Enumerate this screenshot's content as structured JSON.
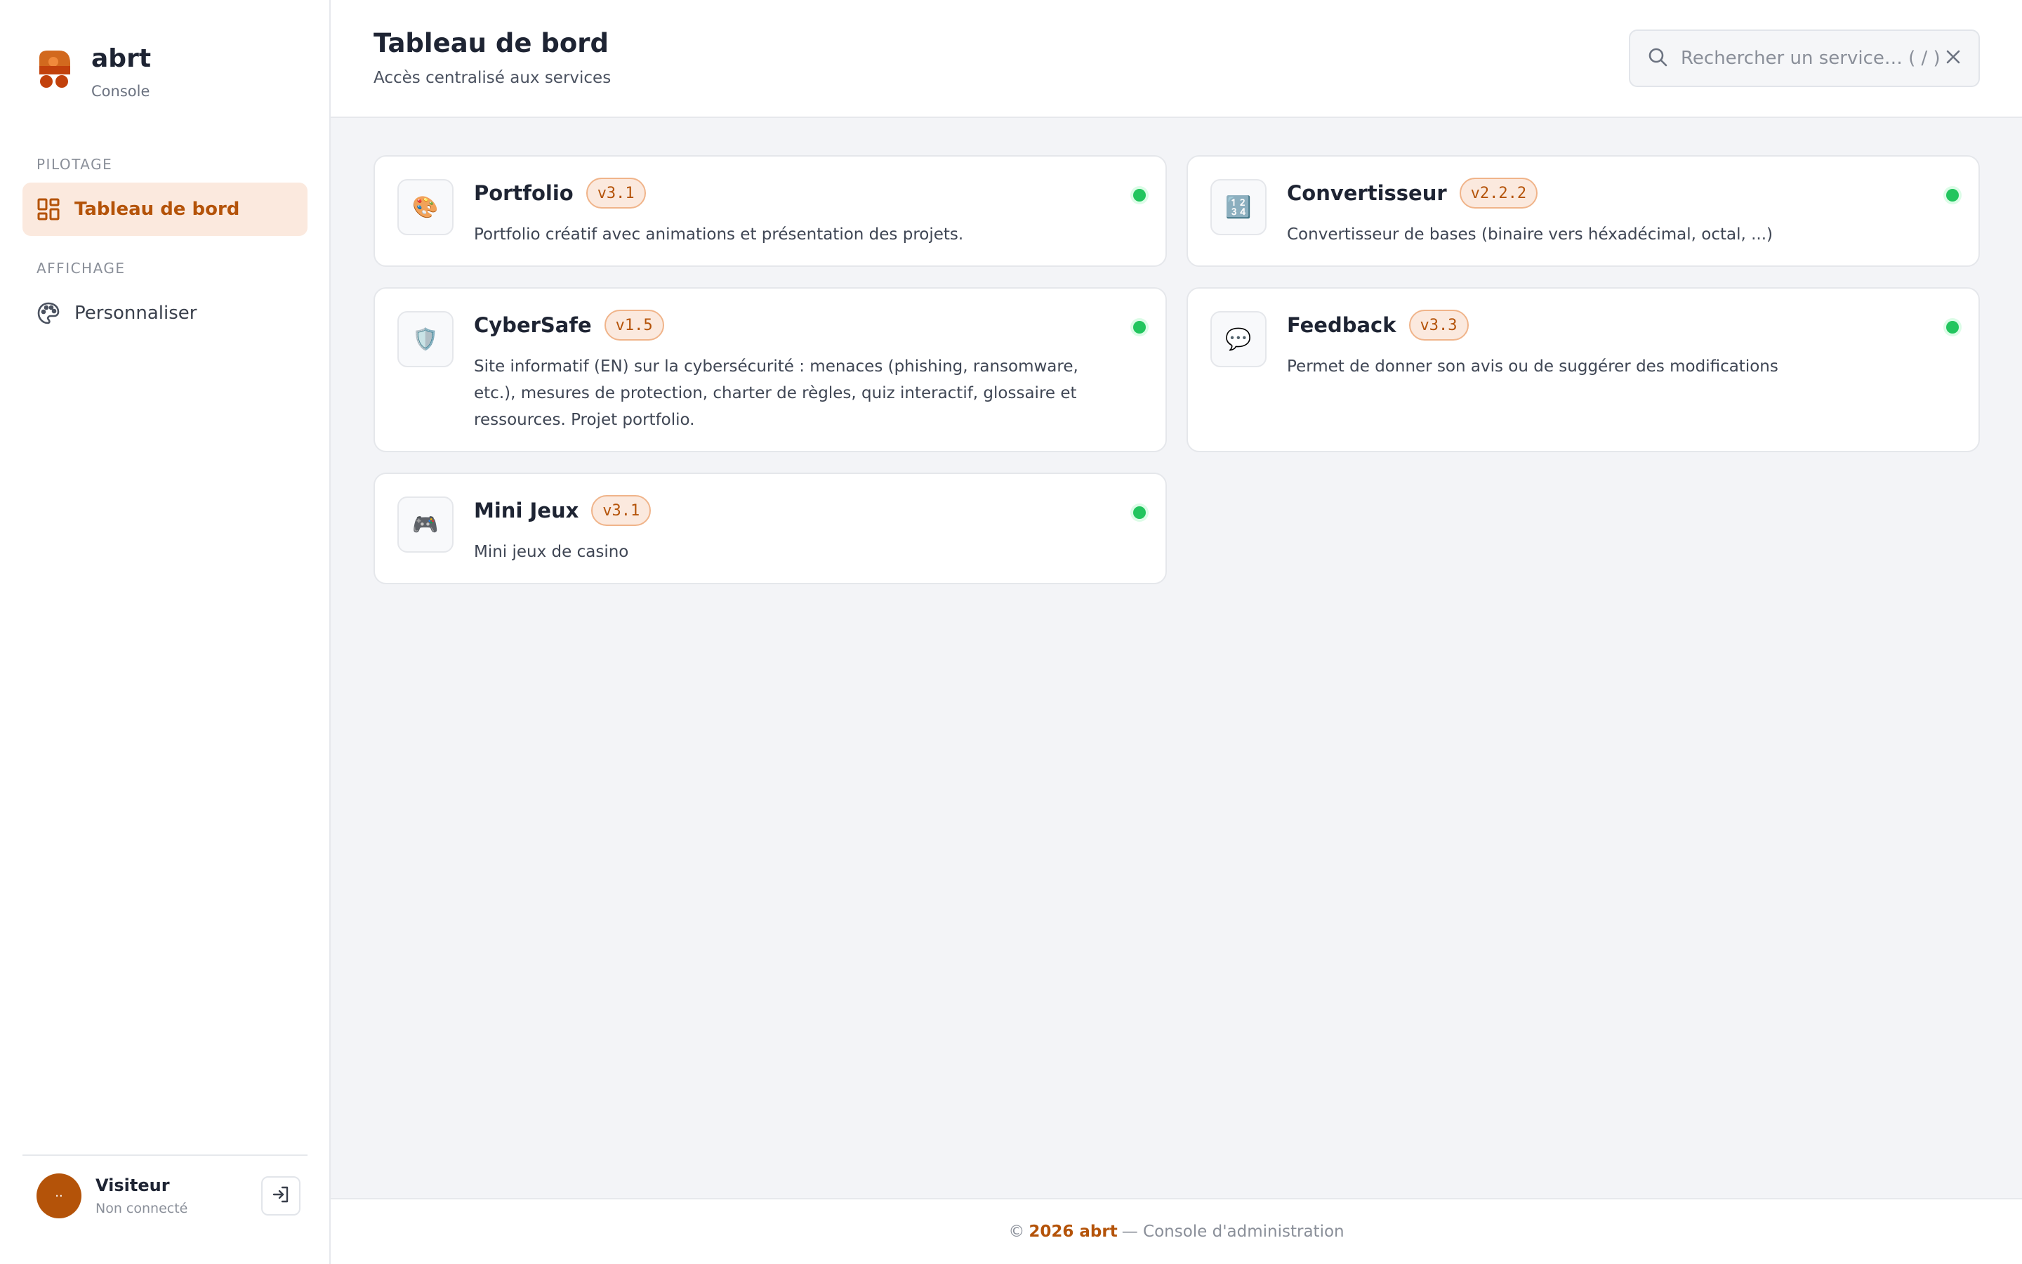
{
  "brand": {
    "name": "abrt",
    "subtitle": "Console"
  },
  "sidebar": {
    "sections": [
      {
        "label": "PILOTAGE",
        "items": [
          {
            "label": "Tableau de bord",
            "icon": "dashboard-grid-icon",
            "active": true
          }
        ]
      },
      {
        "label": "AFFICHAGE",
        "items": [
          {
            "label": "Personnaliser",
            "icon": "palette-icon",
            "active": false
          }
        ]
      }
    ]
  },
  "user": {
    "name": "Visiteur",
    "status": "Non connecté",
    "avatar": "··",
    "logout_icon": "sign-in-icon"
  },
  "header": {
    "title": "Tableau de bord",
    "subtitle": "Accès centralisé aux services",
    "search_placeholder": "Rechercher un service… ( / )"
  },
  "services": [
    {
      "name": "Portfolio",
      "version": "v3.1",
      "icon": "🎨",
      "description": "Portfolio créatif avec animations et présentation des projets.",
      "status": "online"
    },
    {
      "name": "Convertisseur",
      "version": "v2.2.2",
      "icon": "🔢",
      "description": "Convertisseur de bases (binaire vers héxadécimal, octal, ...)",
      "status": "online"
    },
    {
      "name": "CyberSafe",
      "version": "v1.5",
      "icon": "🛡️",
      "description": "Site informatif (EN) sur la cybersécurité : menaces (phishing, ransomware, etc.), mesures de protection, charter de règles, quiz interactif, glossaire et ressources. Projet portfolio.",
      "status": "online"
    },
    {
      "name": "Feedback",
      "version": "v3.3",
      "icon": "💬",
      "description": "Permet de donner son avis ou de suggérer des modifications",
      "status": "online"
    },
    {
      "name": "Mini Jeux",
      "version": "v3.1",
      "icon": "🎮",
      "description": "Mini jeux de casino",
      "status": "online"
    }
  ],
  "footer": {
    "prefix": "©",
    "brand": "2026 abrt",
    "suffix": "— Console d'administration"
  },
  "colors": {
    "accent": "#b45309",
    "accent_bg": "#fbe9de",
    "online": "#22c55e"
  }
}
